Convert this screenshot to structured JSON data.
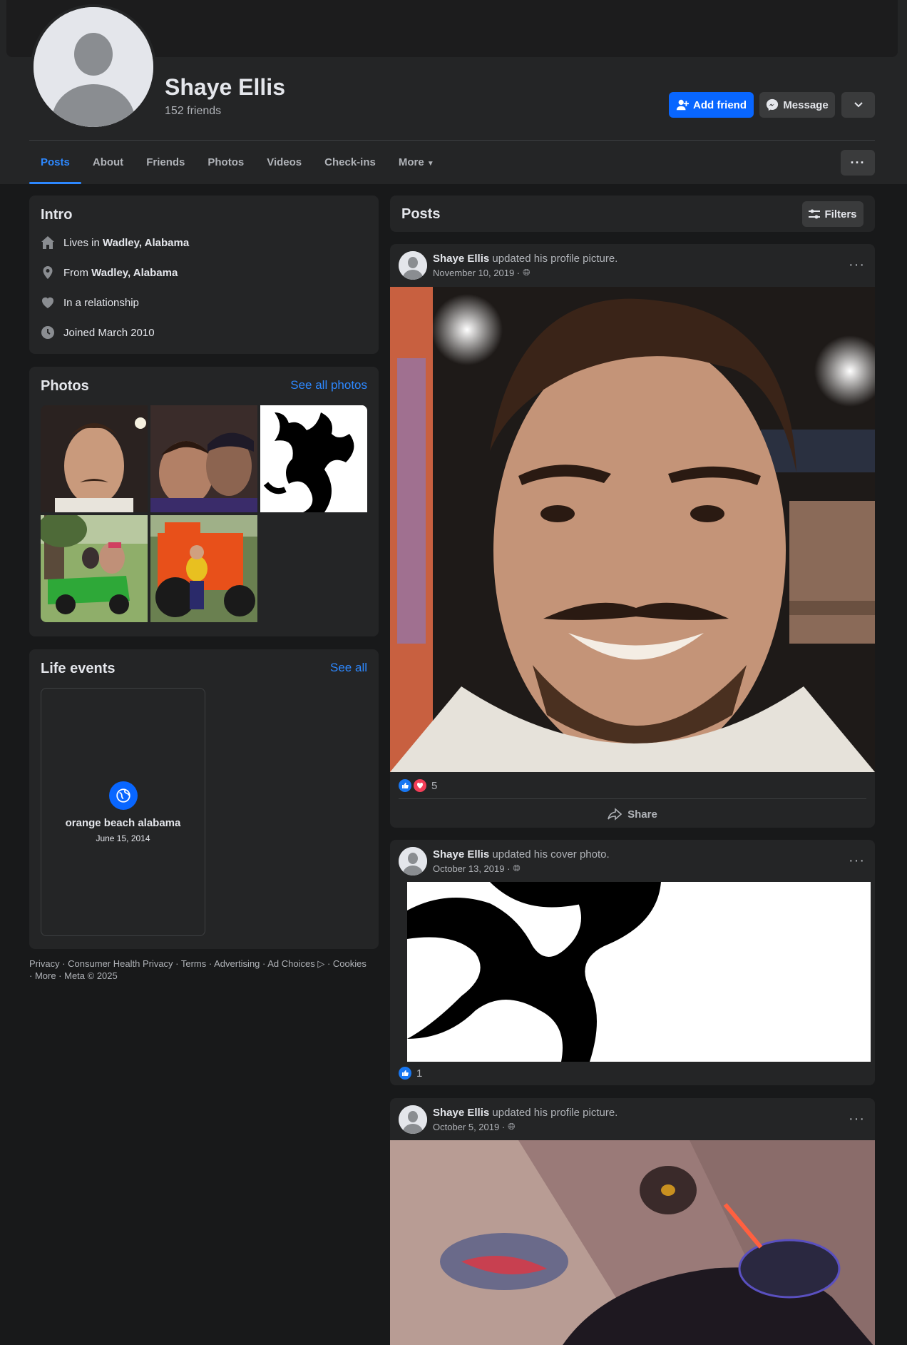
{
  "profile": {
    "name": "Shaye Ellis",
    "friends": "152 friends"
  },
  "actions": {
    "add_friend": "Add friend",
    "message": "Message"
  },
  "tabs": [
    {
      "label": "Posts"
    },
    {
      "label": "About"
    },
    {
      "label": "Friends"
    },
    {
      "label": "Photos"
    },
    {
      "label": "Videos"
    },
    {
      "label": "Check-ins"
    },
    {
      "label": "More"
    }
  ],
  "intro": {
    "title": "Intro",
    "lives_prefix": "Lives in ",
    "lives_place": "Wadley, Alabama",
    "from_prefix": "From ",
    "from_place": "Wadley, Alabama",
    "relationship": "In a relationship",
    "joined": "Joined March 2010"
  },
  "photos": {
    "title": "Photos",
    "see_all": "See all photos"
  },
  "life_events": {
    "title": "Life events",
    "see_all": "See all",
    "event_title": "orange beach alabama",
    "event_date": "June 15, 2014"
  },
  "footer": {
    "text": "Privacy · Consumer Health Privacy · Terms · Advertising · Ad Choices ▷ · Cookies · More · Meta © 2025"
  },
  "posts_header": {
    "title": "Posts",
    "filters": "Filters"
  },
  "posts": [
    {
      "name": "Shaye Ellis",
      "verb": "updated his profile picture.",
      "date": "November 10, 2019 ·",
      "reactions": "5",
      "share": "Share"
    },
    {
      "name": "Shaye Ellis",
      "verb": "updated his cover photo.",
      "date": "October 13, 2019 ·",
      "reactions": "1"
    },
    {
      "name": "Shaye Ellis",
      "verb": "updated his profile picture.",
      "date": "October 5, 2019 ·"
    }
  ],
  "colors": {
    "accent": "#0866ff",
    "link": "#2d88ff",
    "background": "#18191a",
    "card": "#242526",
    "like_blue": "#1877f2",
    "love_red": "#f33e58"
  },
  "icons": [
    "add-friend-icon",
    "messenger-icon",
    "chevron-down-icon",
    "more-dots-icon",
    "home-icon",
    "location-pin-icon",
    "heart-icon",
    "clock-icon",
    "globe-icon",
    "filters-icon",
    "like-icon",
    "love-icon",
    "share-icon"
  ]
}
